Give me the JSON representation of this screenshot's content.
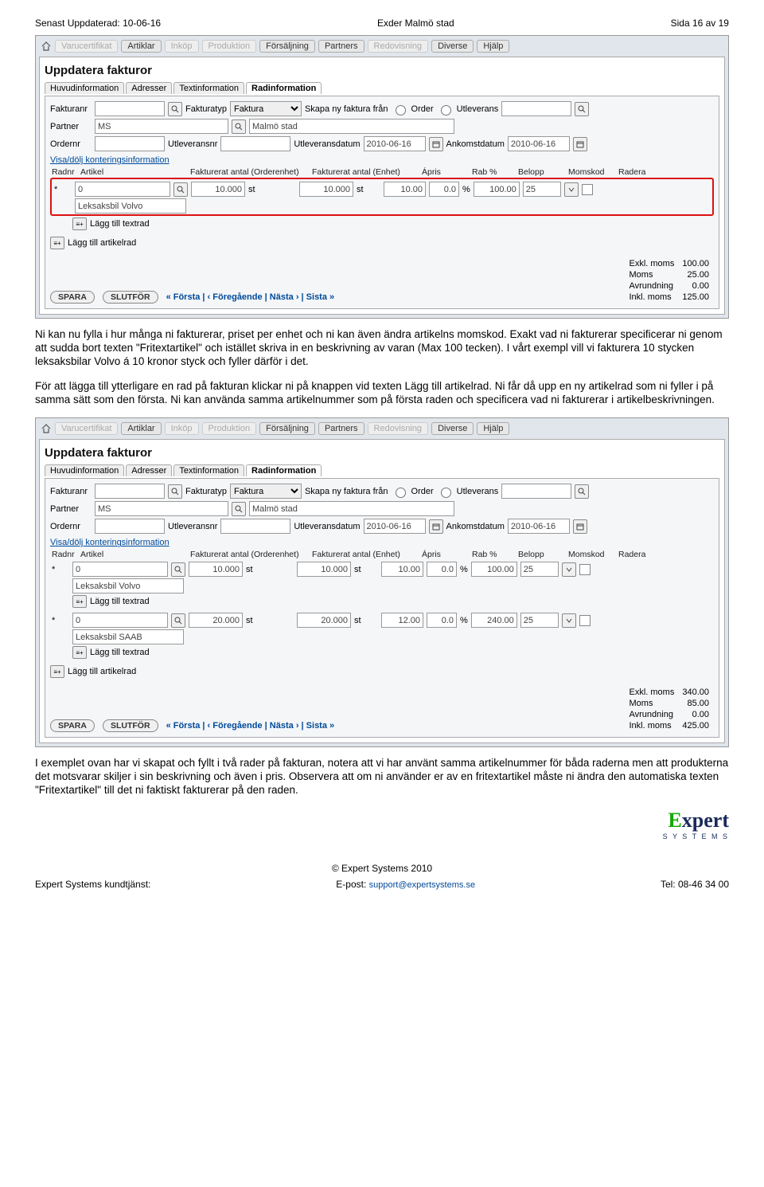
{
  "doc": {
    "updated": "Senast Uppdaterad: 10-06-16",
    "title": "Exder Malmö stad",
    "page": "Sida 16 av 19"
  },
  "nav": {
    "varucertifikat": "Varucertifikat",
    "artiklar": "Artiklar",
    "inkop": "Inköp",
    "produktion": "Produktion",
    "forsaljning": "Försäljning",
    "partners": "Partners",
    "redovisning": "Redovisning",
    "diverse": "Diverse",
    "hjalp": "Hjälp"
  },
  "window": {
    "title": "Uppdatera fakturor",
    "subtabs": {
      "huvud": "Huvudinformation",
      "adresser": "Adresser",
      "textinfo": "Textinformation",
      "radinfo": "Radinformation"
    }
  },
  "labels": {
    "fakturanr": "Fakturanr",
    "fakturatyp": "Fakturatyp",
    "faktura": "Faktura",
    "skapa": "Skapa ny faktura från",
    "order": "Order",
    "utleverans": "Utleverans",
    "partner": "Partner",
    "ordernr": "Ordernr",
    "utleveransnr": "Utleveransnr",
    "utleveransdatum": "Utleveransdatum",
    "ankomstdatum": "Ankomstdatum",
    "ms": "MS",
    "malmo": "Malmö stad",
    "date": "2010-06-16",
    "kontering_link": "Visa/dölj konteringsinformation"
  },
  "th": {
    "radnr": "Radnr",
    "artikel": "Artikel",
    "fakt_order": "Fakturerat antal (Orderenhet)",
    "fakt_enhet": "Fakturerat antal (Enhet)",
    "apris": "Ápris",
    "rab": "Rab %",
    "belopp": "Belopp",
    "momskod": "Momskod",
    "radera": "Radera"
  },
  "row1": {
    "asterisk": "*",
    "artikel": "0",
    "desc": "Leksaksbil Volvo",
    "qty": "10.000",
    "st": "st",
    "qty2": "10.000",
    "apris": "10.00",
    "rab": "0.0",
    "pct": "%",
    "belopp": "100.00",
    "moms": "25",
    "lagg_text": "Lägg till textrad"
  },
  "row2": {
    "artikel": "0",
    "desc": "Leksaksbil SAAB",
    "qty": "20.000",
    "st": "st",
    "qty2": "20.000",
    "apris": "12.00",
    "rab": "0.0",
    "belopp": "240.00",
    "moms": "25",
    "lagg_text": "Lägg till textrad"
  },
  "lagg_artikel": "Lägg till artikelrad",
  "totals1": {
    "exkl_lbl": "Exkl. moms",
    "exkl": "100.00",
    "moms_lbl": "Moms",
    "moms": "25.00",
    "avr_lbl": "Avrundning",
    "avr": "0.00",
    "inkl_lbl": "Inkl. moms",
    "inkl": "125.00"
  },
  "totals2": {
    "exkl": "340.00",
    "moms": "85.00",
    "avr": "0.00",
    "inkl": "425.00"
  },
  "buttons": {
    "spara": "SPARA",
    "slutfor": "SLUTFÖR"
  },
  "pager": "«  Första  |  ‹  Föregående  |  Nästa  ›  |  Sista  »",
  "para1": "Ni kan nu fylla i hur många ni fakturerar, priset per enhet och ni kan även ändra artikelns momskod. Exakt vad ni fakturerar specificerar ni genom att sudda bort texten \"Fritextartikel\" och istället skriva in en beskrivning av varan (Max 100 tecken). I vårt exempl vill vi fakturera 10 stycken leksaksbilar Volvo á 10 kronor styck och fyller därför i det.",
  "para2": "För att lägga till ytterligare en rad på fakturan klickar ni på knappen vid texten Lägg till artikelrad. Ni får då upp en ny artikelrad som ni fyller i på samma sätt som den första. Ni kan använda samma artikelnummer som på första raden och specificera vad ni fakturerar i artikelbeskrivningen.",
  "para3": "I exemplet ovan har vi skapat och fyllt i två rader på fakturan, notera att vi har använt samma artikelnummer för båda raderna men att produkterna det motsvarar skiljer i sin beskrivning och även i pris. Observera att om ni använder er av en fritextartikel måste ni ändra den automatiska texten \"Fritextartikel\" till det ni faktiskt fakturerar på den raden.",
  "footer": {
    "copyright": "© Expert Systems 2010",
    "left": "Expert Systems kundtjänst:",
    "mid_lbl": "E-post: ",
    "mid_link": "support@expertsystems.se",
    "right": "Tel: 08-46 34 00"
  }
}
